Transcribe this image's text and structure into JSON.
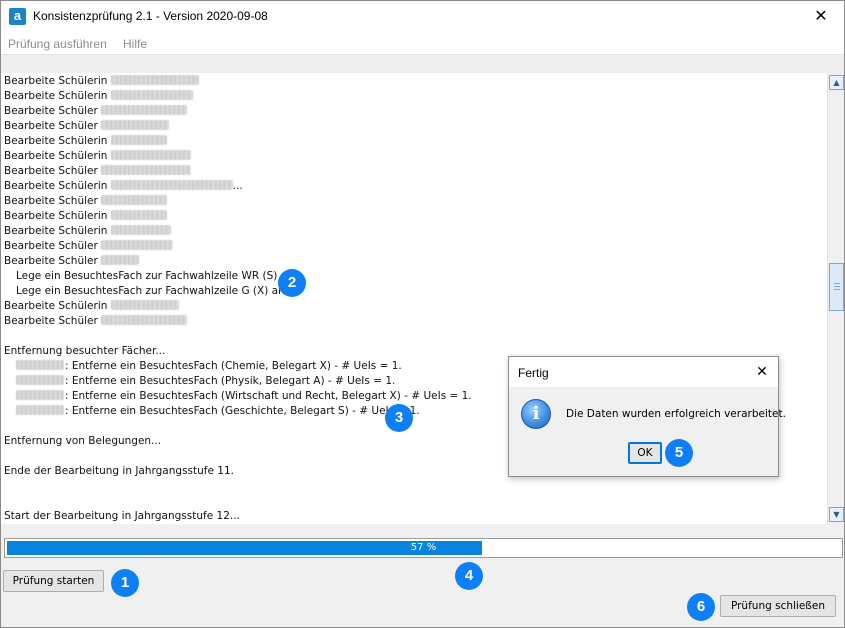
{
  "window": {
    "title": "Konsistenzprüfung 2.1 - Version 2020-09-08",
    "app_icon_letter": "a",
    "close_glyph": "✕"
  },
  "menu": {
    "items": [
      "Prüfung ausführen",
      "Hilfe"
    ]
  },
  "log": {
    "lines": [
      {
        "text": "Bearbeite Schülerin ",
        "redacted": 88
      },
      {
        "text": "Bearbeite Schülerin ",
        "redacted": 82
      },
      {
        "text": "Bearbeite Schüler ",
        "redacted": 86
      },
      {
        "text": "Bearbeite Schüler ",
        "redacted": 68
      },
      {
        "text": "Bearbeite Schülerin ",
        "redacted": 56
      },
      {
        "text": "Bearbeite Schülerin ",
        "redacted": 80
      },
      {
        "text": "Bearbeite Schüler ",
        "redacted": 90
      },
      {
        "text": "Bearbeite Schülerin ",
        "redacted": 122,
        "suffix": "..."
      },
      {
        "text": "Bearbeite Schüler ",
        "redacted": 66
      },
      {
        "text": "Bearbeite Schülerin ",
        "redacted": 56
      },
      {
        "text": "Bearbeite Schülerin ",
        "redacted": 60
      },
      {
        "text": "Bearbeite Schüler ",
        "redacted": 72
      },
      {
        "text": "Bearbeite Schüler ",
        "redacted": 38
      },
      {
        "text": "Lege ein BesuchtesFach zur Fachwahlzeile WR (S) an.",
        "indent": true
      },
      {
        "text": "Lege ein BesuchtesFach zur Fachwahlzeile G (X) an.",
        "indent": true
      },
      {
        "text": "Bearbeite Schülerin ",
        "redacted": 68
      },
      {
        "text": "Bearbeite Schüler ",
        "redacted": 86
      },
      {
        "text": ""
      },
      {
        "text": "Entfernung besuchter Fächer..."
      },
      {
        "text": ": Entferne ein BesuchtesFach (Chemie, Belegart X) - # UeIs = 1.",
        "indent": true,
        "lead_redacted": 48
      },
      {
        "text": ": Entferne ein BesuchtesFach (Physik, Belegart A) - # UeIs = 1.",
        "indent": true,
        "lead_redacted": 48
      },
      {
        "text": ": Entferne ein BesuchtesFach (Wirtschaft und Recht, Belegart X) - # UeIs = 1.",
        "indent": true,
        "lead_redacted": 48
      },
      {
        "text": ": Entferne ein BesuchtesFach (Geschichte, Belegart S) - # UeIs = 1.",
        "indent": true,
        "lead_redacted": 48
      },
      {
        "text": ""
      },
      {
        "text": "Entfernung von Belegungen..."
      },
      {
        "text": ""
      },
      {
        "text": "Ende der Bearbeitung in Jahrgangsstufe 11."
      },
      {
        "text": ""
      },
      {
        "text": ""
      },
      {
        "text": "Start der Bearbeitung in Jahrgangsstufe 12..."
      }
    ]
  },
  "progress": {
    "value": 0.57,
    "label": "57 %"
  },
  "buttons": {
    "start": "Prüfung starten",
    "close": "Prüfung schließen"
  },
  "dialog": {
    "title": "Fertig",
    "message": "Die Daten wurden erfolgreich verarbeitet.",
    "ok": "OK",
    "icon": "info-icon",
    "close_glyph": "✕"
  },
  "badges": [
    "1",
    "2",
    "3",
    "4",
    "5",
    "6"
  ],
  "colors": {
    "badge": "#0f7ff5",
    "progress": "#0a84de",
    "app_icon": "#1b84c6"
  }
}
